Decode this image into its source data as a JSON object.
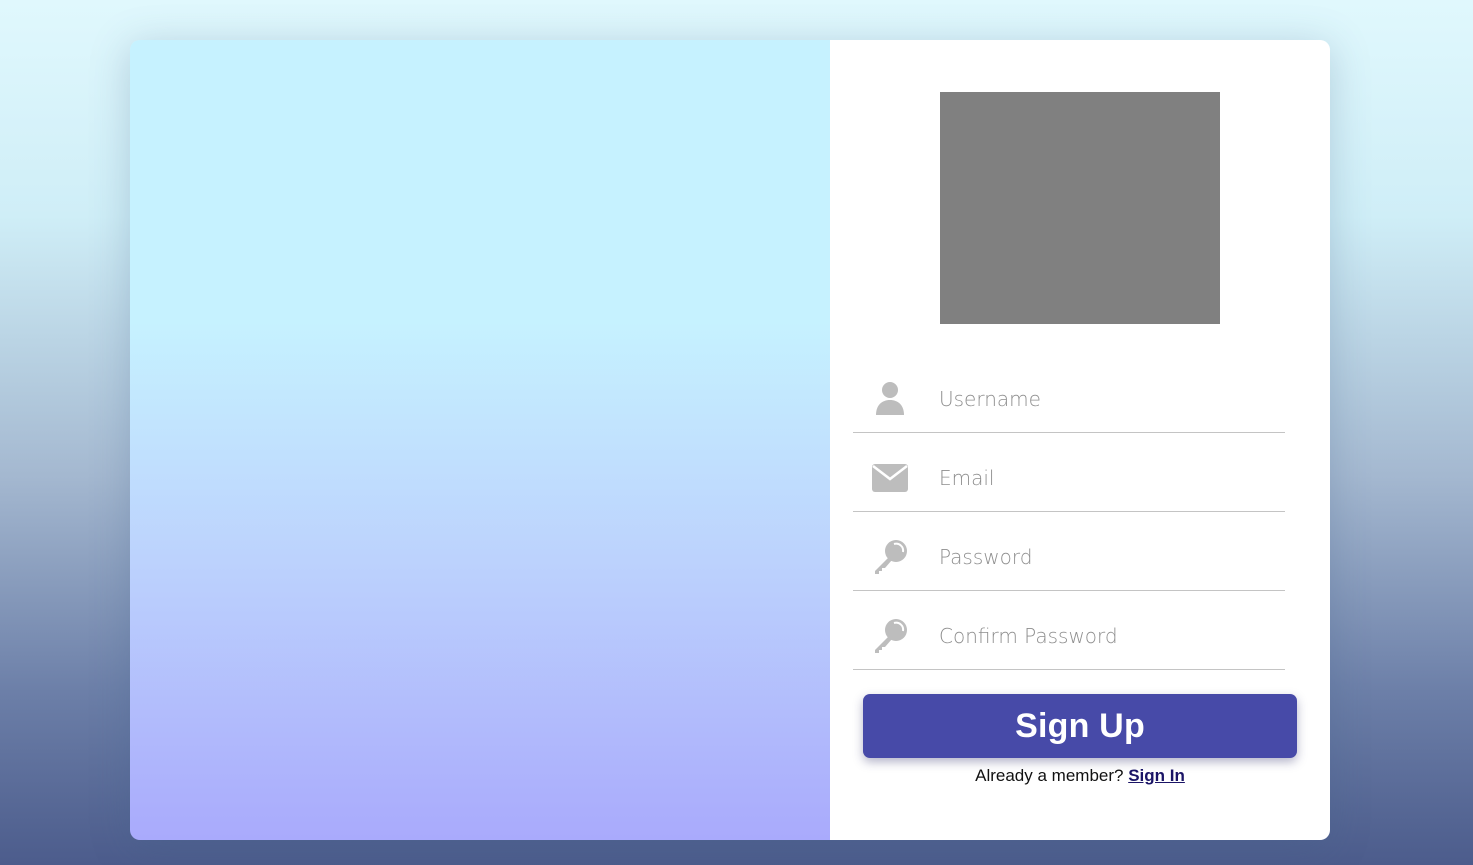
{
  "form": {
    "username_placeholder": "Username",
    "email_placeholder": "Email",
    "password_placeholder": "Password",
    "confirm_password_placeholder": "Confirm Password",
    "signup_label": "Sign Up",
    "member_prompt": "Already a member?",
    "signin_label": "Sign In"
  },
  "icons": {
    "username": "user-icon",
    "email": "envelope-icon",
    "password": "key-icon",
    "confirm_password": "key-icon"
  },
  "colors": {
    "button": "#474aa8",
    "link": "#1a1466",
    "placeholder": "#8e8e8e",
    "icon": "#bdbdbd",
    "logo_placeholder": "#808080"
  }
}
